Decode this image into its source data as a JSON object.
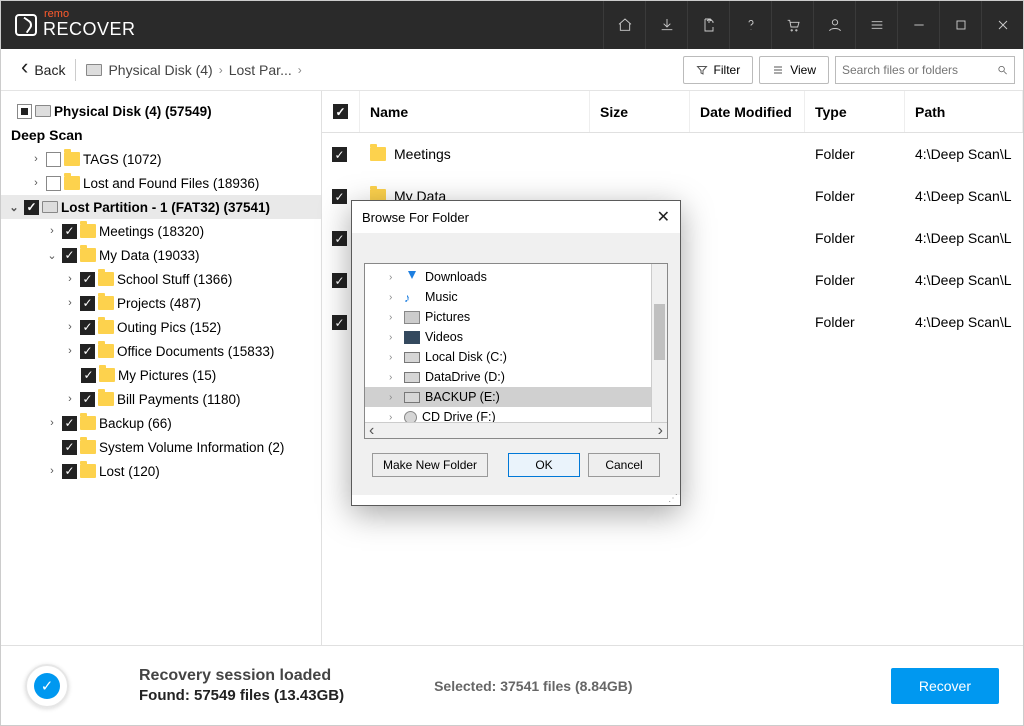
{
  "brand": {
    "top": "remo",
    "main": "RECOVER"
  },
  "toolbar": {
    "back": "Back",
    "crumb1": "Physical Disk (4)",
    "crumb2": "Lost Par...",
    "filter": "Filter",
    "view": "View",
    "search_placeholder": "Search files or folders"
  },
  "sidebar": {
    "root": "Physical Disk (4) (57549)",
    "deep_scan": "Deep Scan",
    "items": [
      {
        "label": "TAGS (1072)"
      },
      {
        "label": "Lost and Found Files (18936)"
      },
      {
        "label": "Lost Partition - 1 (FAT32) (37541)"
      },
      {
        "label": "Meetings (18320)"
      },
      {
        "label": "My Data (19033)"
      },
      {
        "label": "School Stuff (1366)"
      },
      {
        "label": "Projects (487)"
      },
      {
        "label": "Outing Pics (152)"
      },
      {
        "label": "Office Documents (15833)"
      },
      {
        "label": "My Pictures (15)"
      },
      {
        "label": "Bill Payments (1180)"
      },
      {
        "label": "Backup (66)"
      },
      {
        "label": "System Volume Information (2)"
      },
      {
        "label": "Lost (120)"
      }
    ]
  },
  "columns": {
    "name": "Name",
    "size": "Size",
    "date": "Date Modified",
    "type": "Type",
    "path": "Path"
  },
  "rows": [
    {
      "name": "Meetings",
      "type": "Folder",
      "path": "4:\\Deep Scan\\L"
    },
    {
      "name": "My Data",
      "type": "Folder",
      "path": "4:\\Deep Scan\\L"
    },
    {
      "name": "",
      "type": "Folder",
      "path": "4:\\Deep Scan\\L"
    },
    {
      "name": "",
      "type": "Folder",
      "path": "4:\\Deep Scan\\L"
    },
    {
      "name": "",
      "type": "Folder",
      "path": "4:\\Deep Scan\\L"
    }
  ],
  "dialog": {
    "title": "Browse For Folder",
    "items": [
      {
        "label": "Downloads",
        "kind": "dl"
      },
      {
        "label": "Music",
        "kind": "music"
      },
      {
        "label": "Pictures",
        "kind": "pic"
      },
      {
        "label": "Videos",
        "kind": "vid"
      },
      {
        "label": "Local Disk (C:)",
        "kind": "drv"
      },
      {
        "label": "DataDrive (D:)",
        "kind": "drv"
      },
      {
        "label": "BACKUP (E:)",
        "kind": "drv",
        "selected": true
      },
      {
        "label": "CD Drive (F:)",
        "kind": "cd"
      }
    ],
    "make": "Make New Folder",
    "ok": "OK",
    "cancel": "Cancel"
  },
  "status": {
    "line1": "Recovery session loaded",
    "line2": "Found: 57549 files (13.43GB)",
    "selected": "Selected: 37541 files (8.84GB)",
    "recover": "Recover"
  }
}
